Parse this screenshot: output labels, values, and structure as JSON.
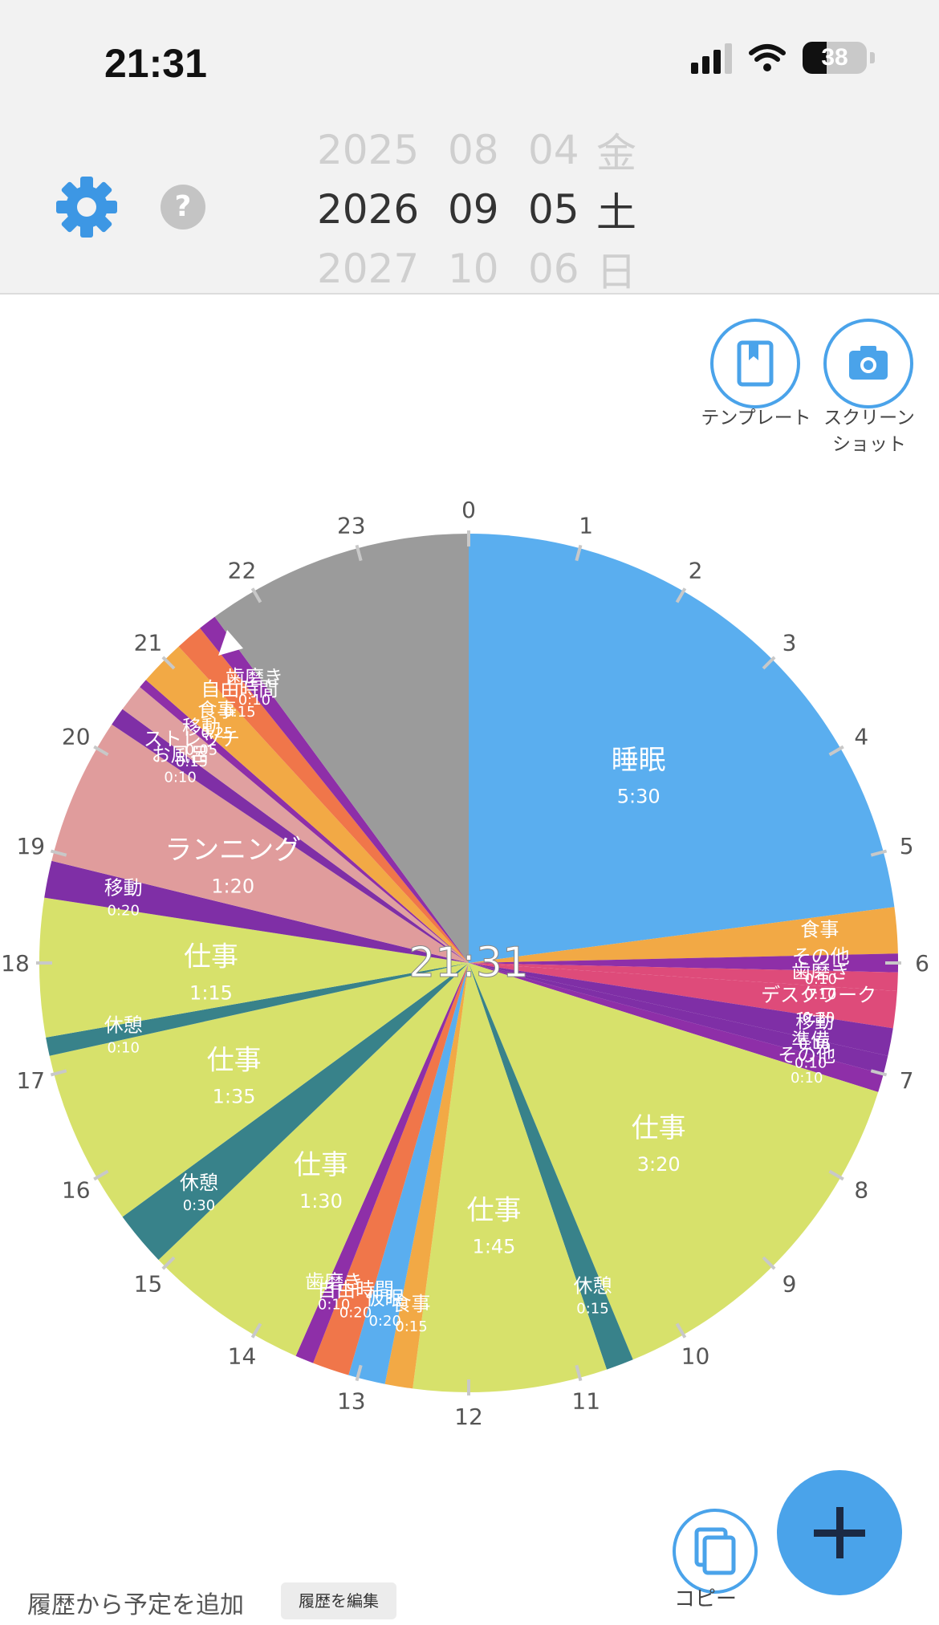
{
  "status_bar": {
    "time": "21:31",
    "battery": "38"
  },
  "header": {
    "picker": {
      "prev": {
        "year": "2025",
        "month": "08",
        "day": "04",
        "weekday": "金"
      },
      "selected": {
        "year": "2026",
        "month": "09",
        "day": "05",
        "weekday": "土"
      },
      "next": {
        "year": "2027",
        "month": "10",
        "day": "06",
        "weekday": "日"
      }
    },
    "help_label": "?"
  },
  "actions": {
    "template_label": "テンプレート",
    "screenshot_label": [
      "スクリーン",
      "ショット"
    ],
    "copy_label": "コピー"
  },
  "footer": {
    "history_text": "履歴から予定を追加",
    "edit_history_label": "履歴を編集"
  },
  "colors": {
    "sleep": "#5aaeef",
    "meal": "#f2a945",
    "other": "#8e2fa8",
    "toothbrush": "#de4b7a",
    "desk": "#d6e06a",
    "move": "#7f2fa6",
    "prep": "#7f2fa6",
    "work": "#d7e16b",
    "break": "#38828a",
    "free": "#f0764a",
    "bath": "#e0a0a0",
    "running": "#e09c9c",
    "stretch": "#e0a0a0",
    "unassigned": "#9b9b9b",
    "accent": "#4aa3ea"
  },
  "chart_data": {
    "type": "pie",
    "title": "",
    "center_label": "21:31",
    "hour_ticks": [
      "0",
      "1",
      "2",
      "3",
      "4",
      "5",
      "6",
      "7",
      "8",
      "9",
      "10",
      "11",
      "12",
      "13",
      "14",
      "15",
      "16",
      "17",
      "18",
      "19",
      "20",
      "21",
      "22",
      "23"
    ],
    "slices": [
      {
        "label": "睡眠",
        "duration": "5:30",
        "start": 0,
        "end": 330,
        "color": "#5aaeef"
      },
      {
        "label": "食事",
        "duration": "",
        "start": 330,
        "end": 355,
        "color": "#f2a945"
      },
      {
        "label": "その他",
        "duration": "0:10",
        "start": 355,
        "end": 365,
        "color": "#8e2fa8"
      },
      {
        "label": "歯磨き",
        "duration": "0:10",
        "start": 365,
        "end": 375,
        "color": "#de4b7a"
      },
      {
        "label": "デスクワーク",
        "duration": "0:20",
        "start": 375,
        "end": 395,
        "color": "#de4b7a"
      },
      {
        "label": "移動",
        "duration": "0:15",
        "start": 395,
        "end": 410,
        "color": "#7f2fa6"
      },
      {
        "label": "準備",
        "duration": "0:10",
        "start": 410,
        "end": 420,
        "color": "#7f2fa6"
      },
      {
        "label": "その他",
        "duration": "0:10",
        "start": 420,
        "end": 430,
        "color": "#8e2fa8"
      },
      {
        "label": "仕事",
        "duration": "3:20",
        "start": 430,
        "end": 630,
        "color": "#d7e16b"
      },
      {
        "label": "休憩",
        "duration": "0:15",
        "start": 630,
        "end": 645,
        "color": "#38828a"
      },
      {
        "label": "仕事",
        "duration": "1:45",
        "start": 645,
        "end": 750,
        "color": "#d7e16b"
      },
      {
        "label": "食事",
        "duration": "0:15",
        "start": 750,
        "end": 765,
        "color": "#f2a945"
      },
      {
        "label": "仮眠",
        "duration": "0:20",
        "start": 765,
        "end": 785,
        "color": "#5aaeef"
      },
      {
        "label": "自由時間",
        "duration": "0:20",
        "start": 785,
        "end": 805,
        "color": "#f0764a"
      },
      {
        "label": "歯磨き",
        "duration": "0:10",
        "start": 805,
        "end": 815,
        "color": "#8e2fa8"
      },
      {
        "label": "仕事",
        "duration": "1:30",
        "start": 815,
        "end": 905,
        "color": "#d7e16b"
      },
      {
        "label": "休憩",
        "duration": "0:30",
        "start": 905,
        "end": 935,
        "color": "#38828a"
      },
      {
        "label": "仕事",
        "duration": "1:35",
        "start": 935,
        "end": 1030,
        "color": "#d7e16b"
      },
      {
        "label": "休憩",
        "duration": "0:10",
        "start": 1030,
        "end": 1040,
        "color": "#38828a"
      },
      {
        "label": "仕事",
        "duration": "1:15",
        "start": 1040,
        "end": 1115,
        "color": "#d7e16b"
      },
      {
        "label": "移動",
        "duration": "0:20",
        "start": 1115,
        "end": 1135,
        "color": "#7f2fa6"
      },
      {
        "label": "ランニング",
        "duration": "1:20",
        "start": 1135,
        "end": 1215,
        "color": "#e09c9c"
      },
      {
        "label": "お風呂",
        "duration": "0:10",
        "start": 1215,
        "end": 1225,
        "color": "#7f2fa6"
      },
      {
        "label": "ストレッチ",
        "duration": "0:15",
        "start": 1225,
        "end": 1240,
        "color": "#e0a0a0"
      },
      {
        "label": "移動",
        "duration": "0:05",
        "start": 1240,
        "end": 1245,
        "color": "#8e2fa8"
      },
      {
        "label": "食事",
        "duration": "0:25",
        "start": 1245,
        "end": 1270,
        "color": "#f2a945"
      },
      {
        "label": "自由時間",
        "duration": "0:15",
        "start": 1270,
        "end": 1285,
        "color": "#f0764a"
      },
      {
        "label": "歯磨き",
        "duration": "0:10",
        "start": 1285,
        "end": 1295,
        "color": "#8e2fa8"
      },
      {
        "label": "",
        "duration": "",
        "start": 1295,
        "end": 1440,
        "color": "#9b9b9b"
      }
    ]
  }
}
